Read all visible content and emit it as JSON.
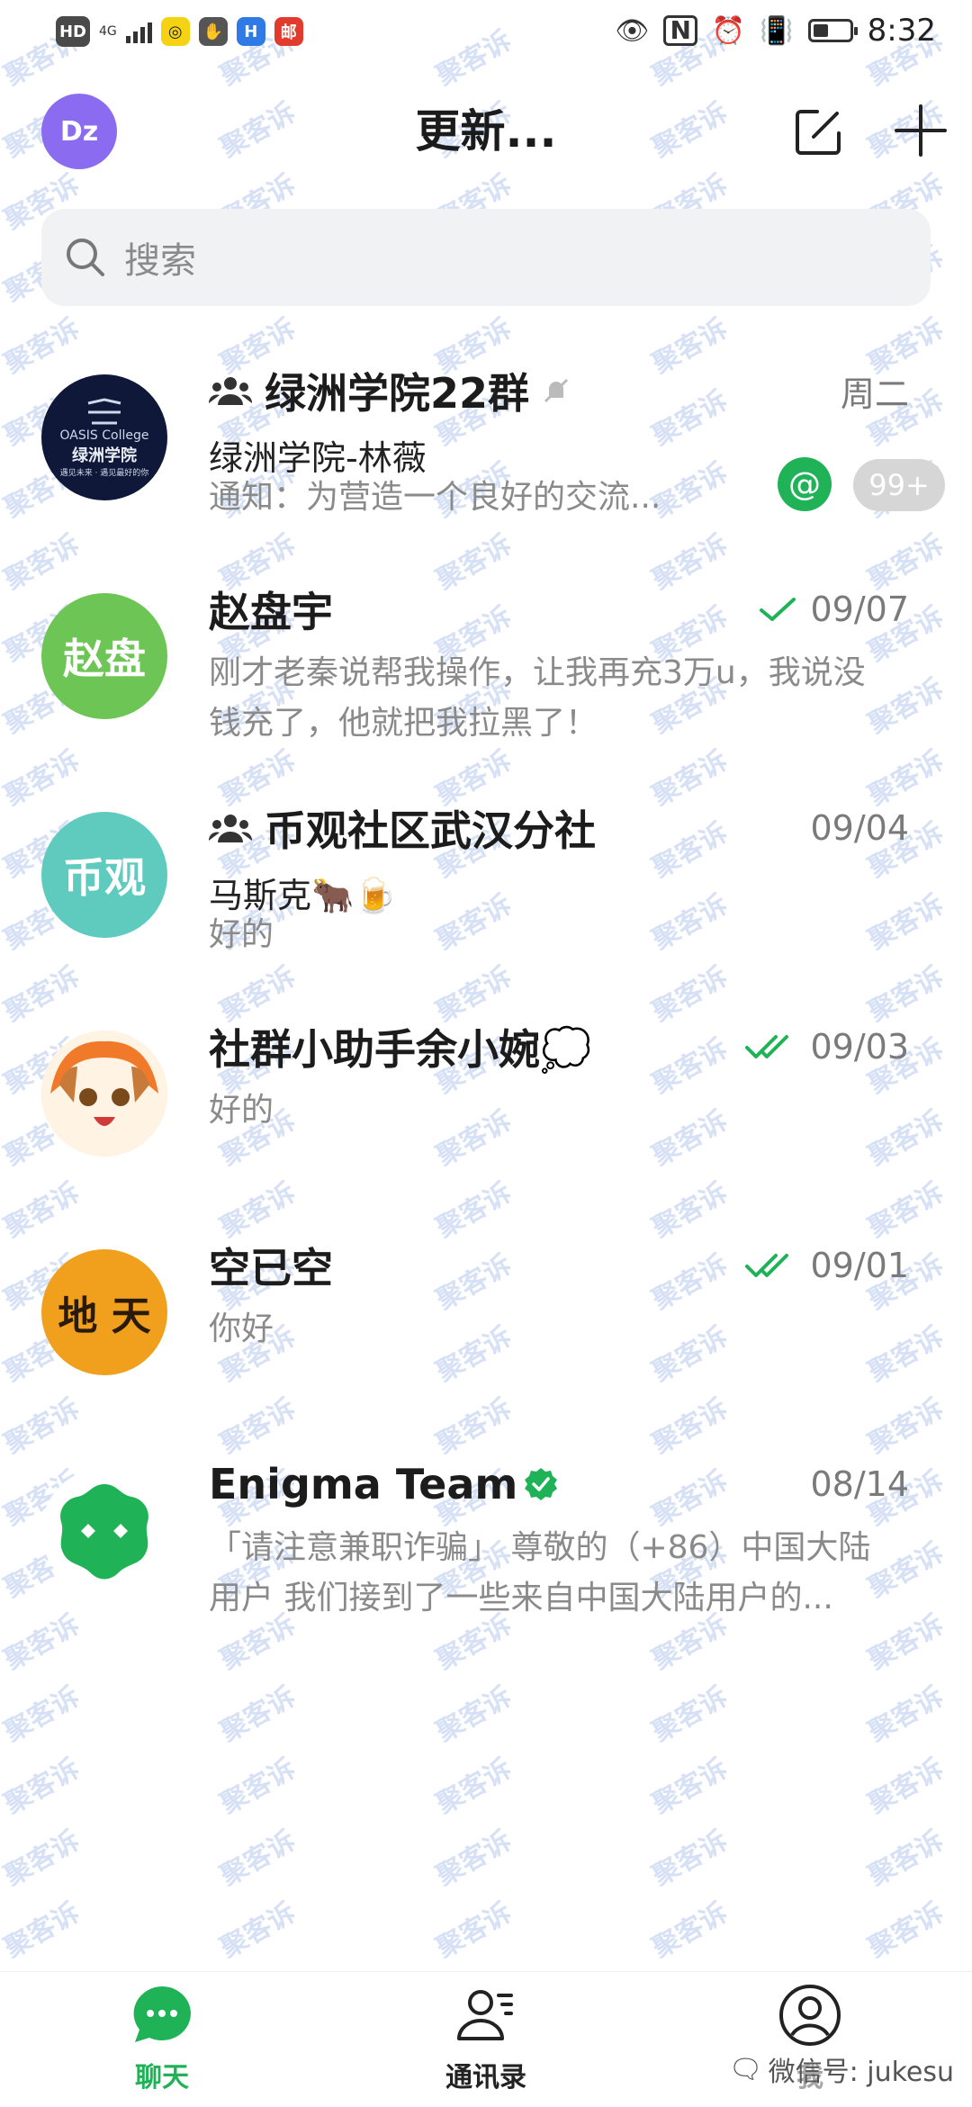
{
  "status_bar": {
    "hd": "HD",
    "net": "4G",
    "time": "8:32",
    "battery_level": 0.42
  },
  "header": {
    "avatar_initials": "Dz",
    "title": "更新..."
  },
  "search": {
    "placeholder": "搜索"
  },
  "chats": [
    {
      "name": "绿洲学院22群",
      "is_group": true,
      "muted": true,
      "date": "周二",
      "sender": "绿洲学院-林薇",
      "preview": "通知：为营造一个良好的交流...",
      "avatar_lines": [
        "OASIS College",
        "绿洲学院",
        "遇见未来 · 遇见最好的你"
      ],
      "badge_at": "@",
      "badge_count": "99+"
    },
    {
      "name": "赵盘宇",
      "avatar_text": "赵盘",
      "avatar_color": "#6cc554",
      "date": "09/07",
      "read_state": "single-check-icon",
      "preview_lines": [
        "刚才老秦说帮我操作，让我再充3万u，我说没",
        "钱充了，他就把我拉黑了！"
      ]
    },
    {
      "name": "币观社区武汉分社",
      "is_group": true,
      "avatar_text": "币观",
      "avatar_color": "#5fcbbf",
      "date": "09/04",
      "sender": "马斯克🐂🍺",
      "preview": "好的"
    },
    {
      "name": "社群小助手余小婉💭",
      "date": "09/03",
      "read_state": "double-check-icon",
      "preview": "好的"
    },
    {
      "name": "空已空",
      "avatar_text": "地 天",
      "avatar_color": "#f0a01c",
      "date": "09/01",
      "read_state": "double-check-icon",
      "preview": "你好"
    },
    {
      "name": "Enigma Team",
      "verified": true,
      "date": "08/14",
      "preview_lines": [
        "「请注意兼职诈骗」 尊敬的（+86）中国大陆",
        "用户 我们接到了一些来自中国大陆用户的..."
      ]
    }
  ],
  "tabbar": {
    "chats": "聊天",
    "contacts": "通讯录",
    "me": "我"
  },
  "watermark": "聚客诉",
  "wechat_mark": "微信号: jukesu",
  "colors": {
    "accent": "#1fb257",
    "at_badge": "#1fb257",
    "count_badge": "#d6d6d6"
  }
}
